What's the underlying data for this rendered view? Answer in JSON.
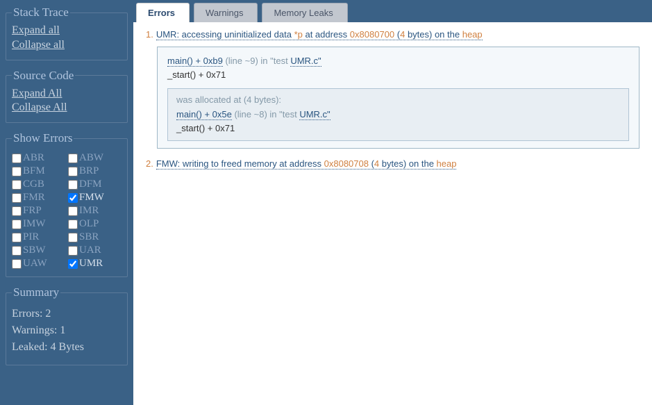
{
  "sidebar": {
    "stackTrace": {
      "legend": "Stack Trace",
      "expand": "Expand all",
      "collapse": "Collapse all"
    },
    "sourceCode": {
      "legend": "Source Code",
      "expand": "Expand All",
      "collapse": "Collapse All"
    },
    "showErrors": {
      "legend": "Show Errors",
      "filters": [
        {
          "code": "ABR",
          "checked": false
        },
        {
          "code": "ABW",
          "checked": false
        },
        {
          "code": "BFM",
          "checked": false
        },
        {
          "code": "BRP",
          "checked": false
        },
        {
          "code": "CGB",
          "checked": false
        },
        {
          "code": "DFM",
          "checked": false
        },
        {
          "code": "FMR",
          "checked": false
        },
        {
          "code": "FMW",
          "checked": true
        },
        {
          "code": "FRP",
          "checked": false
        },
        {
          "code": "IMR",
          "checked": false
        },
        {
          "code": "IMW",
          "checked": false
        },
        {
          "code": "OLP",
          "checked": false
        },
        {
          "code": "PIR",
          "checked": false
        },
        {
          "code": "SBR",
          "checked": false
        },
        {
          "code": "SBW",
          "checked": false
        },
        {
          "code": "UAR",
          "checked": false
        },
        {
          "code": "UAW",
          "checked": false
        },
        {
          "code": "UMR",
          "checked": true
        }
      ]
    },
    "summary": {
      "legend": "Summary",
      "errors": "Errors: 2",
      "warnings": "Warnings: 1",
      "leaked": "Leaked: 4 Bytes"
    }
  },
  "tabs": {
    "errors": "Errors",
    "warnings": "Warnings",
    "memleaks": "Memory Leaks"
  },
  "errors": [
    {
      "num": "1.",
      "pre": "UMR: accessing uninitialized data ",
      "deref": "*p",
      "mid": " at address ",
      "addr": "0x8080700",
      "midb": " (",
      "bytes": "4",
      "post": " bytes) on the ",
      "heap": "heap",
      "trace": {
        "func": "main() + 0xb9",
        "line": " (line ~9) in \"test  ",
        "file": "UMR.c\"",
        "below": "_start() + 0x71"
      },
      "alloc": {
        "head": "was allocated at (4 bytes):",
        "func": "main() + 0x5e",
        "line": " (line ~8) in \"test  ",
        "file": "UMR.c\"",
        "below": "_start() + 0x71"
      }
    },
    {
      "num": "2.",
      "pre": "FMW: writing to freed memory at address ",
      "deref": "",
      "mid": "",
      "addr": "0x8080708",
      "midb": " (",
      "bytes": "4",
      "post": " bytes) on the ",
      "heap": "heap"
    }
  ]
}
